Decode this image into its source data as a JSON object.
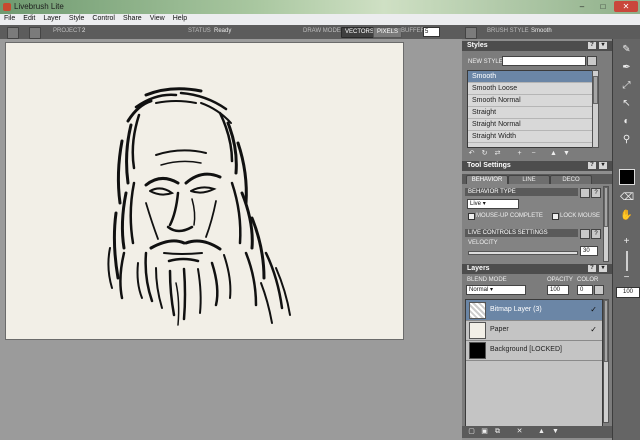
{
  "window": {
    "title": "Livebrush Lite",
    "minimize": "‒",
    "maximize": "□",
    "close": "✕"
  },
  "menu": [
    "File",
    "Edit",
    "Layer",
    "Style",
    "Control",
    "Share",
    "View",
    "Help"
  ],
  "toolbar": {
    "project_label": "PROJECT",
    "project_value": "2",
    "status_label": "STATUS",
    "status_value": "Ready",
    "draw_mode_label": "DRAW MODE",
    "vectors_label": "VECTORS",
    "pixels_label": "PIXELS",
    "buffer_label": "BUFFER",
    "buffer_value": "5",
    "brush_style_label": "BRUSH STYLE",
    "brush_style_value": "Smooth"
  },
  "styles_panel": {
    "title": "Styles",
    "help": "?",
    "menu": "▾",
    "close": "✕",
    "new_style_label": "NEW STYLE",
    "new_style_value": "",
    "items": [
      "Smooth",
      "Smooth Loose",
      "Smooth Normal",
      "Straight",
      "Straight Normal",
      "Straight Width"
    ],
    "selected": "Smooth",
    "plus": "+",
    "minus": "−",
    "up": "▲",
    "down": "▼"
  },
  "tool_settings": {
    "title": "Tool Settings",
    "tabs": [
      "BEHAVIOR",
      "LINE",
      "DECO"
    ],
    "active_tab": "BEHAVIOR",
    "behavior_type_label": "BEHAVIOR TYPE",
    "behavior_type_value": "Live",
    "mouse_up_complete_label": "MOUSE-UP COMPLETE",
    "lock_mouse_label": "LOCK MOUSE",
    "live_controls_label": "LIVE CONTROLS SETTINGS",
    "velocity_label": "VELOCITY",
    "velocity_value": "30",
    "help": "?"
  },
  "layers": {
    "title": "Layers",
    "blend_mode_label": "BLEND MODE",
    "blend_mode_value": "Normal",
    "opacity_label": "OPACITY",
    "opacity_value": "100",
    "color_label": "COLOR",
    "color_value": "0",
    "items": [
      {
        "name": "Bitmap Layer (3)",
        "checked": "✓"
      },
      {
        "name": "Paper",
        "checked": "✓"
      },
      {
        "name": "Background [LOCKED]",
        "checked": ""
      }
    ],
    "selected": "Bitmap Layer (3)"
  },
  "right_toolbar": {
    "zoom_value": "100",
    "zoom_in": "+",
    "zoom_out": "−"
  },
  "colors": {
    "panel_header": "#4d4d4d",
    "selection": "#6b86a6",
    "canvas": "#f2efe7",
    "stroke": "#111111"
  }
}
